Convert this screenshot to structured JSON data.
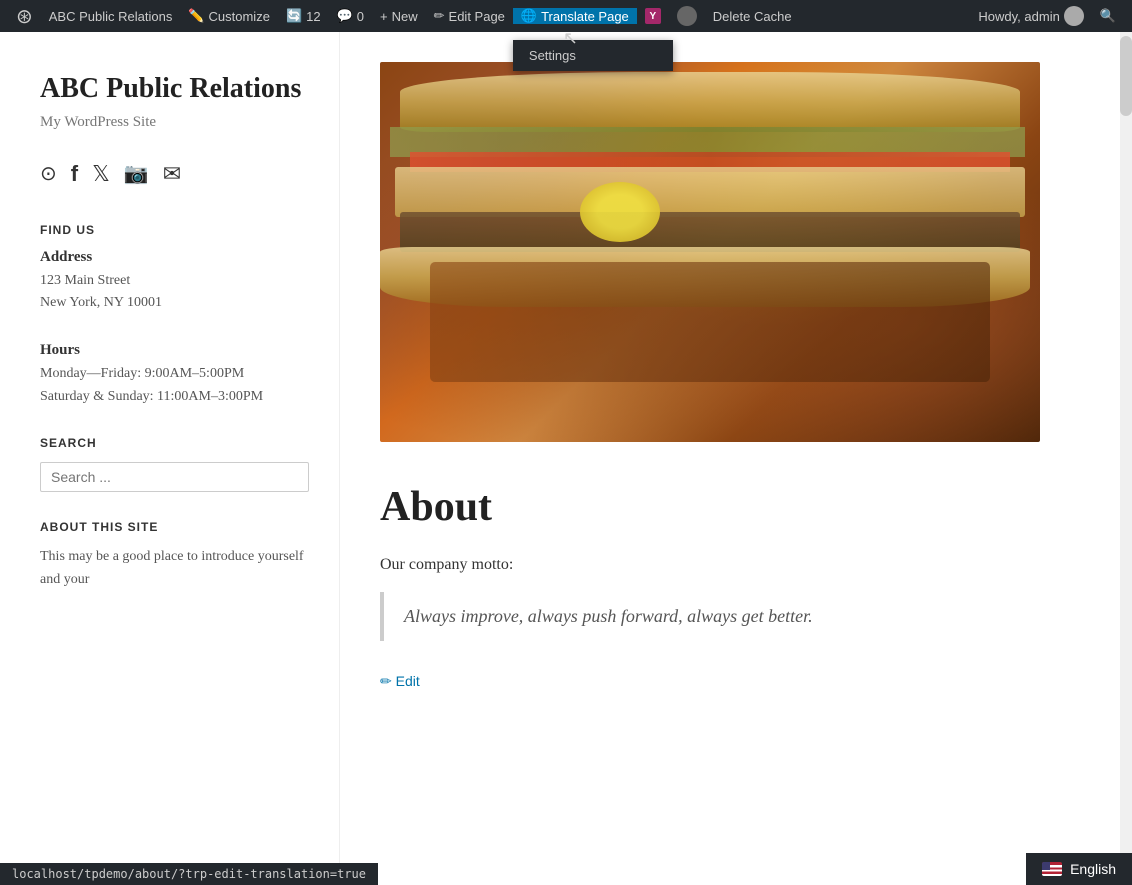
{
  "admin_bar": {
    "wp_logo": "⊕",
    "site_name": "ABC Public Relations",
    "customize_label": "Customize",
    "revisions_label": "12",
    "comments_label": "0",
    "new_label": "New",
    "edit_page_label": "Edit Page",
    "translate_page_label": "Translate Page",
    "yoast_label": "Y",
    "delete_cache_label": "Delete Cache",
    "howdy_label": "Howdy, admin",
    "search_icon": "🔍",
    "translate_dropdown": {
      "visible": true,
      "items": [
        "Settings"
      ]
    }
  },
  "sidebar": {
    "site_title": "ABC Public Relations",
    "site_tagline": "My WordPress Site",
    "social_icons": [
      {
        "name": "rss-icon",
        "symbol": "◉"
      },
      {
        "name": "facebook-icon",
        "symbol": "f"
      },
      {
        "name": "twitter-icon",
        "symbol": "𝕏"
      },
      {
        "name": "instagram-icon",
        "symbol": "📷"
      },
      {
        "name": "email-icon",
        "symbol": "✉"
      }
    ],
    "find_us_title": "FIND US",
    "address_label": "Address",
    "address_line1": "123 Main Street",
    "address_line2": "New York, NY 10001",
    "hours_label": "Hours",
    "hours_weekday": "Monday—Friday: 9:00AM–5:00PM",
    "hours_weekend": "Saturday & Sunday: 11:00AM–3:00PM",
    "search_title": "SEARCH",
    "search_placeholder": "Search ...",
    "about_site_title": "ABOUT THIS SITE",
    "about_site_text": "This may be a good place to introduce yourself and your"
  },
  "main": {
    "hero_image_alt": "Sandwich food photo",
    "page_heading": "About",
    "motto_label": "Our company motto:",
    "blockquote_text": "Always improve, always push forward, always get better.",
    "edit_link_label": "Edit"
  },
  "status_bar": {
    "url": "localhost/tpdemo/about/?trp-edit-translation=true"
  },
  "language_switcher": {
    "language": "English"
  }
}
